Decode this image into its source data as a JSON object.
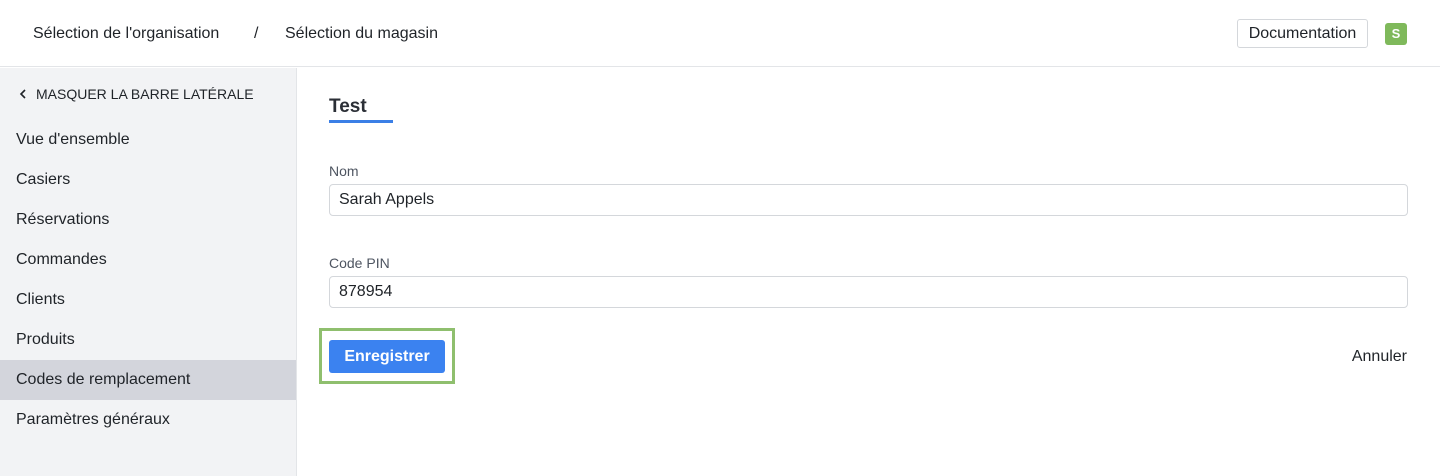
{
  "header": {
    "breadcrumb_org": "Sélection de l'organisation",
    "breadcrumb_separator": "/",
    "breadcrumb_store": "Sélection du magasin",
    "documentation_label": "Documentation",
    "avatar_initial": "S",
    "avatar_color": "#7fb95b"
  },
  "sidebar": {
    "collapse_label": "MASQUER LA BARRE LATÉRALE",
    "collapse_icon": "chevron-left-icon",
    "items": [
      {
        "label": "Vue d'ensemble",
        "active": false
      },
      {
        "label": "Casiers",
        "active": false
      },
      {
        "label": "Réservations",
        "active": false
      },
      {
        "label": "Commandes",
        "active": false
      },
      {
        "label": "Clients",
        "active": false
      },
      {
        "label": "Produits",
        "active": false
      },
      {
        "label": "Codes de remplacement",
        "active": true
      },
      {
        "label": "Paramètres généraux",
        "active": false
      }
    ]
  },
  "form": {
    "title": "Test",
    "name_label": "Nom",
    "name_value": "Sarah Appels",
    "pin_label": "Code PIN",
    "pin_value": "878954",
    "save_label": "Enregistrer",
    "cancel_label": "Annuler",
    "accent_color": "#3b82f0"
  }
}
